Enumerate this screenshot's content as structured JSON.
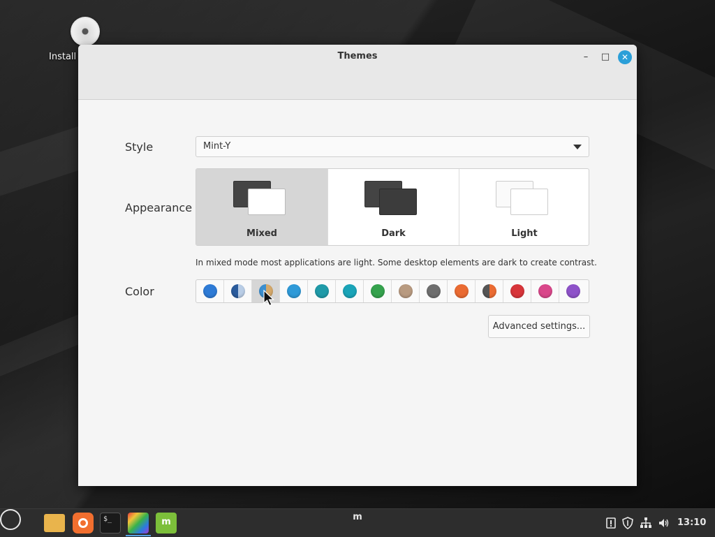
{
  "desktop": {
    "icon_label": "Install"
  },
  "window": {
    "title": "Themes",
    "controls": {
      "minimize": "–",
      "maximize": "□",
      "close": "✕"
    }
  },
  "style": {
    "label": "Style",
    "value": "Mint-Y"
  },
  "appearance": {
    "label": "Appearance",
    "options": [
      {
        "label": "Mixed",
        "selected": true
      },
      {
        "label": "Dark",
        "selected": false
      },
      {
        "label": "Light",
        "selected": false
      }
    ],
    "hint": "In mixed mode most applications are light. Some desktop elements are dark to create contrast."
  },
  "color": {
    "label": "Color",
    "swatches": [
      {
        "name": "blue",
        "color": "#2e7bd6"
      },
      {
        "name": "aqua-split",
        "color": "#2a5b9c",
        "color2": "#b9cde6"
      },
      {
        "name": "sand-split",
        "color": "#3b8fd0",
        "color2": "#d4a86a",
        "selected": true
      },
      {
        "name": "sky",
        "color": "#2f9ad8"
      },
      {
        "name": "teal",
        "color": "#1f9aa8"
      },
      {
        "name": "cyan",
        "color": "#1aa4b8"
      },
      {
        "name": "green",
        "color": "#35a24d"
      },
      {
        "name": "sand",
        "color": "#b89a80"
      },
      {
        "name": "grey",
        "color": "#6e6e6e"
      },
      {
        "name": "orange",
        "color": "#ea6b32"
      },
      {
        "name": "orange-split",
        "color": "#555555",
        "color2": "#ea6b32"
      },
      {
        "name": "red",
        "color": "#d7353a"
      },
      {
        "name": "pink",
        "color": "#d9478a"
      },
      {
        "name": "purple",
        "color": "#8e52c9"
      }
    ]
  },
  "advanced_button": "Advanced settings...",
  "taskbar": {
    "menu_icon": "m",
    "terminal_glyph": "$_",
    "mintupdate_glyph": "m",
    "clock": "13:10"
  },
  "icons": {
    "desktop_icon": "disc-icon",
    "files": "folder-icon",
    "firefox": "firefox-icon",
    "terminal": "terminal-icon",
    "themes": "themes-icon",
    "update": "mint-update-icon",
    "tray": [
      "notification-icon",
      "shield-icon",
      "network-icon",
      "volume-icon"
    ]
  }
}
